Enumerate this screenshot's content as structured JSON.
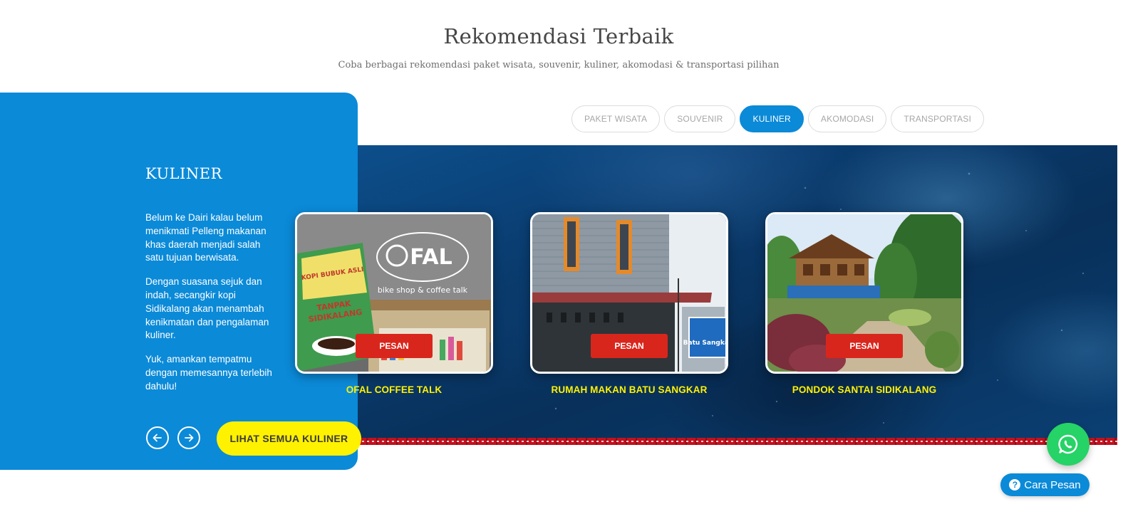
{
  "header": {
    "title": "Rekomendasi Terbaik",
    "subtitle": "Coba berbagai rekomendasi paket wisata, souvenir, kuliner, akomodasi & transportasi pilihan"
  },
  "tabs": [
    {
      "label": "PAKET WISATA",
      "active": false
    },
    {
      "label": "SOUVENIR",
      "active": false
    },
    {
      "label": "KULINER",
      "active": true
    },
    {
      "label": "AKOMODASI",
      "active": false
    },
    {
      "label": "TRANSPORTASI",
      "active": false
    }
  ],
  "panel": {
    "title": "KULINER",
    "paragraphs": [
      "Belum ke Dairi kalau belum menikmati Pelleng makanan khas daerah menjadi salah satu tujuan berwisata.",
      "Dengan suasana sejuk dan indah, secangkir kopi Sidikalang akan menambah kenikmatan dan pengalaman kuliner.",
      "Yuk, amankan tempatmu dengan memesannya terlebih dahulu!"
    ],
    "prev_icon": "arrow-left-icon",
    "next_icon": "arrow-right-icon",
    "see_all_label": "LIHAT SEMUA KULINER"
  },
  "cards": [
    {
      "name": "OFAL COFFEE TALK",
      "button": "PESAN",
      "sign_text": "FAL",
      "sign_sub": "bike shop & coffee talk",
      "pack_text": [
        "KOPI BUBUK ASLI",
        "TANPAK",
        "SIDIKALANG"
      ]
    },
    {
      "name": "RUMAH MAKAN BATU SANGKAR",
      "button": "PESAN",
      "sign_text": "Batu Sangkar"
    },
    {
      "name": "PONDOK SANTAI SIDIKALANG",
      "button": "PESAN"
    }
  ],
  "colors": {
    "primary_blue": "#0b8ad8",
    "yellow": "#fff200",
    "red_button": "#d9261c",
    "whatsapp_green": "#25d366"
  },
  "floating": {
    "whatsapp_icon": "whatsapp-icon",
    "cara_pesan_label": "Cara Pesan",
    "help_icon": "question-circle-icon"
  }
}
